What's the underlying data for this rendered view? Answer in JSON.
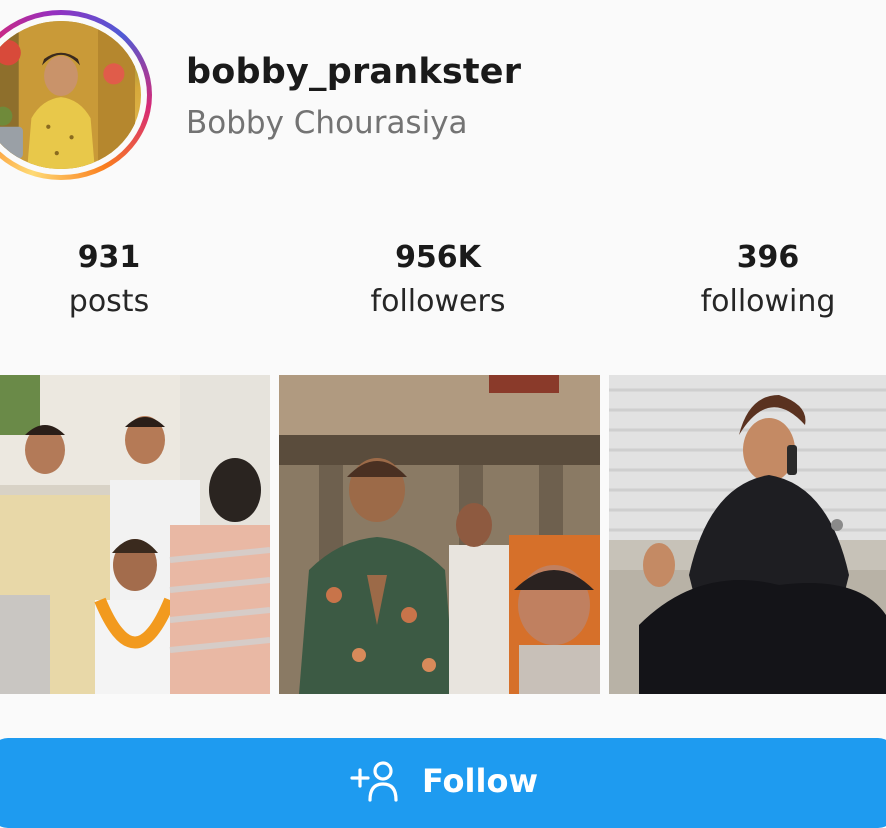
{
  "profile": {
    "username": "bobby_prankster",
    "full_name": "Bobby Chourasiya"
  },
  "stats": [
    {
      "value": "931",
      "label": "posts"
    },
    {
      "value": "956K",
      "label": "followers"
    },
    {
      "value": "396",
      "label": "following"
    }
  ],
  "posts": [
    {
      "icon": "photo-crowd-garland"
    },
    {
      "icon": "photo-temple-namaste"
    },
    {
      "icon": "photo-phone-call-shutter"
    }
  ],
  "follow_button": {
    "label": "Follow",
    "icon": "add-user-icon"
  },
  "colors": {
    "accent": "#1e9bf0",
    "background": "#fafafa",
    "secondary_text": "#737373"
  }
}
